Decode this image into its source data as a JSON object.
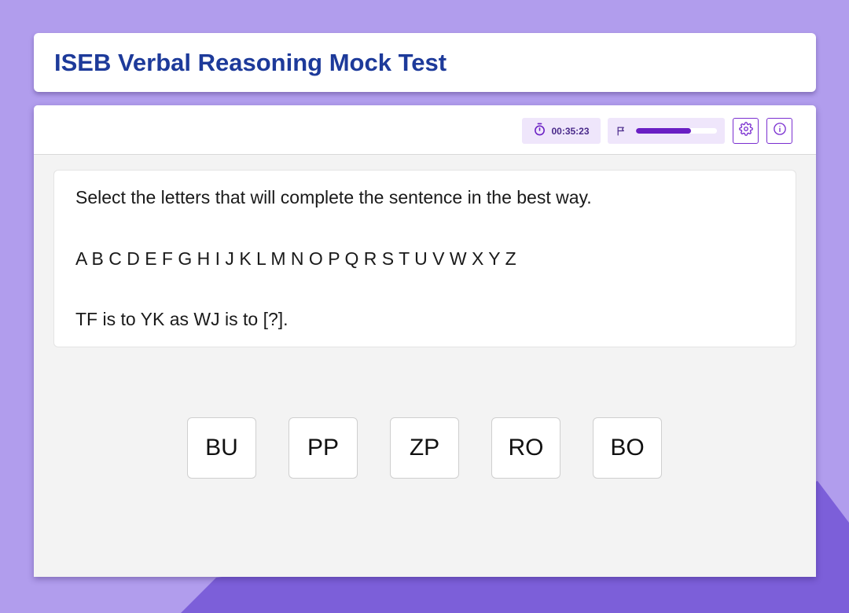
{
  "page": {
    "title": "ISEB Verbal Reasoning Mock Test"
  },
  "toolbar": {
    "timer": "00:35:23",
    "timer_icon": "stopwatch-icon",
    "flag_icon": "flag-icon",
    "progress_fraction": 0.68,
    "settings_icon": "gear-icon",
    "info_icon": "info-icon"
  },
  "question": {
    "instruction": "Select the letters that will complete the sentence in the best way.",
    "alphabet": "A B C D E F G H I J K L M N O P Q R S T U V W X Y Z",
    "prompt": "TF is to YK as WJ is to [?]."
  },
  "answers": [
    {
      "label": "BU"
    },
    {
      "label": "PP"
    },
    {
      "label": "ZP"
    },
    {
      "label": "RO"
    },
    {
      "label": "BO"
    }
  ],
  "colors": {
    "background": "#b19ded",
    "background_accent": "#7c5fd9",
    "title_text": "#1d3a9a",
    "accent": "#6a1fc4",
    "chip_background": "#efe6fb"
  }
}
